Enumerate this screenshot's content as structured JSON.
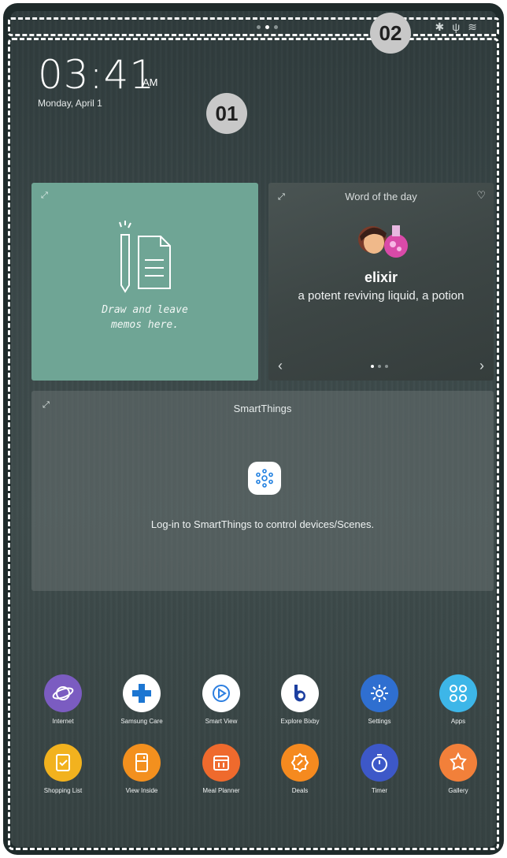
{
  "callouts": {
    "status_bar": "02",
    "home_screen": "01"
  },
  "clock": {
    "time": "03:41",
    "ampm": "AM",
    "date": "Monday, April 1"
  },
  "memo_widget": {
    "caption_line1": "Draw and leave",
    "caption_line2": "memos here.",
    "color": "#6fa595"
  },
  "word_widget": {
    "title": "Word of the day",
    "term": "elixir",
    "definition": "a potent reviving liquid, a potion",
    "pager_count": 3,
    "pager_active": 0
  },
  "smartthings": {
    "title": "SmartThings",
    "message": "Log-in to SmartThings to control devices/Scenes."
  },
  "apps_row1": [
    {
      "label": "Internet",
      "color": "#7b5cc1",
      "icon": "planet-icon"
    },
    {
      "label": "Samsung Care",
      "color": "#ffffff",
      "icon": "plus-icon"
    },
    {
      "label": "Smart View",
      "color": "#ffffff",
      "icon": "smart-view-icon"
    },
    {
      "label": "Explore Bixby",
      "color": "#ffffff",
      "icon": "bixby-icon"
    },
    {
      "label": "Settings",
      "color": "#2f6fd0",
      "icon": "gear-icon"
    },
    {
      "label": "Apps",
      "color": "#3db6e8",
      "icon": "apps-grid-icon"
    }
  ],
  "apps_row2": [
    {
      "label": "Shopping List",
      "color": "#f2b21e",
      "icon": "shopping-list-icon"
    },
    {
      "label": "View Inside",
      "color": "#f3901e",
      "icon": "fridge-icon"
    },
    {
      "label": "Meal Planner",
      "color": "#ef6a2d",
      "icon": "meal-planner-icon"
    },
    {
      "label": "Deals",
      "color": "#f58a1f",
      "icon": "deals-icon"
    },
    {
      "label": "Timer",
      "color": "#3d58c8",
      "icon": "timer-icon"
    },
    {
      "label": "Gallery",
      "color": "#f2803a",
      "icon": "gallery-icon"
    }
  ]
}
